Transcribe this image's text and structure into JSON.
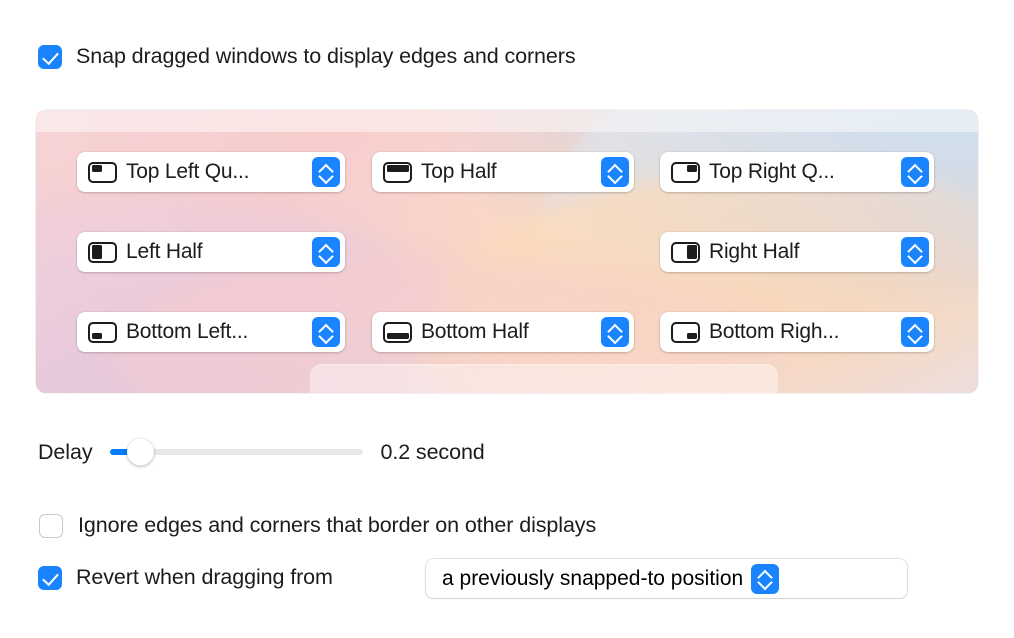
{
  "snap_checkbox": {
    "label": "Snap dragged windows to display edges and corners",
    "checked": true
  },
  "preview": {
    "zones": [
      {
        "id": "top-left-quarter",
        "icon": "window-top-left-quarter-icon",
        "label": "Top Left Qu..."
      },
      {
        "id": "top-half",
        "icon": "window-top-half-icon",
        "label": "Top Half"
      },
      {
        "id": "top-right-quarter",
        "icon": "window-top-right-quarter-icon",
        "label": "Top Right Q..."
      },
      {
        "id": "left-half",
        "icon": "window-left-half-icon",
        "label": "Left Half"
      },
      {
        "id": "right-half",
        "icon": "window-right-half-icon",
        "label": "Right Half"
      },
      {
        "id": "bottom-left-quarter",
        "icon": "window-bottom-left-quarter-icon",
        "label": "Bottom Left..."
      },
      {
        "id": "bottom-half",
        "icon": "window-bottom-half-icon",
        "label": "Bottom Half"
      },
      {
        "id": "bottom-right-quarter",
        "icon": "window-bottom-right-quarter-icon",
        "label": "Bottom Righ..."
      }
    ]
  },
  "delay": {
    "label": "Delay",
    "value_text": "0.2 second",
    "percent": 7
  },
  "ignore_checkbox": {
    "label": "Ignore edges and corners that border on other displays",
    "checked": false
  },
  "revert_checkbox": {
    "label": "Revert when dragging from",
    "checked": true
  },
  "revert_popup": {
    "selected": "a previously snapped-to position"
  },
  "colors": {
    "accent": "#1a84ff",
    "slider_fill": "#067cf9",
    "text": "#1c1c1e",
    "panel_bg": "#ffffff"
  }
}
